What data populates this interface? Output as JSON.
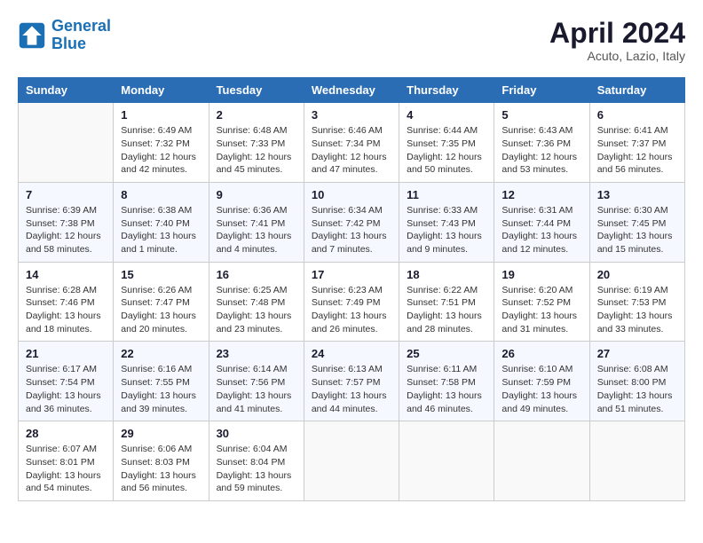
{
  "header": {
    "logo_line1": "General",
    "logo_line2": "Blue",
    "month_title": "April 2024",
    "subtitle": "Acuto, Lazio, Italy"
  },
  "weekdays": [
    "Sunday",
    "Monday",
    "Tuesday",
    "Wednesday",
    "Thursday",
    "Friday",
    "Saturday"
  ],
  "weeks": [
    [
      {
        "day": "",
        "info": ""
      },
      {
        "day": "1",
        "info": "Sunrise: 6:49 AM\nSunset: 7:32 PM\nDaylight: 12 hours\nand 42 minutes."
      },
      {
        "day": "2",
        "info": "Sunrise: 6:48 AM\nSunset: 7:33 PM\nDaylight: 12 hours\nand 45 minutes."
      },
      {
        "day": "3",
        "info": "Sunrise: 6:46 AM\nSunset: 7:34 PM\nDaylight: 12 hours\nand 47 minutes."
      },
      {
        "day": "4",
        "info": "Sunrise: 6:44 AM\nSunset: 7:35 PM\nDaylight: 12 hours\nand 50 minutes."
      },
      {
        "day": "5",
        "info": "Sunrise: 6:43 AM\nSunset: 7:36 PM\nDaylight: 12 hours\nand 53 minutes."
      },
      {
        "day": "6",
        "info": "Sunrise: 6:41 AM\nSunset: 7:37 PM\nDaylight: 12 hours\nand 56 minutes."
      }
    ],
    [
      {
        "day": "7",
        "info": "Sunrise: 6:39 AM\nSunset: 7:38 PM\nDaylight: 12 hours\nand 58 minutes."
      },
      {
        "day": "8",
        "info": "Sunrise: 6:38 AM\nSunset: 7:40 PM\nDaylight: 13 hours\nand 1 minute."
      },
      {
        "day": "9",
        "info": "Sunrise: 6:36 AM\nSunset: 7:41 PM\nDaylight: 13 hours\nand 4 minutes."
      },
      {
        "day": "10",
        "info": "Sunrise: 6:34 AM\nSunset: 7:42 PM\nDaylight: 13 hours\nand 7 minutes."
      },
      {
        "day": "11",
        "info": "Sunrise: 6:33 AM\nSunset: 7:43 PM\nDaylight: 13 hours\nand 9 minutes."
      },
      {
        "day": "12",
        "info": "Sunrise: 6:31 AM\nSunset: 7:44 PM\nDaylight: 13 hours\nand 12 minutes."
      },
      {
        "day": "13",
        "info": "Sunrise: 6:30 AM\nSunset: 7:45 PM\nDaylight: 13 hours\nand 15 minutes."
      }
    ],
    [
      {
        "day": "14",
        "info": "Sunrise: 6:28 AM\nSunset: 7:46 PM\nDaylight: 13 hours\nand 18 minutes."
      },
      {
        "day": "15",
        "info": "Sunrise: 6:26 AM\nSunset: 7:47 PM\nDaylight: 13 hours\nand 20 minutes."
      },
      {
        "day": "16",
        "info": "Sunrise: 6:25 AM\nSunset: 7:48 PM\nDaylight: 13 hours\nand 23 minutes."
      },
      {
        "day": "17",
        "info": "Sunrise: 6:23 AM\nSunset: 7:49 PM\nDaylight: 13 hours\nand 26 minutes."
      },
      {
        "day": "18",
        "info": "Sunrise: 6:22 AM\nSunset: 7:51 PM\nDaylight: 13 hours\nand 28 minutes."
      },
      {
        "day": "19",
        "info": "Sunrise: 6:20 AM\nSunset: 7:52 PM\nDaylight: 13 hours\nand 31 minutes."
      },
      {
        "day": "20",
        "info": "Sunrise: 6:19 AM\nSunset: 7:53 PM\nDaylight: 13 hours\nand 33 minutes."
      }
    ],
    [
      {
        "day": "21",
        "info": "Sunrise: 6:17 AM\nSunset: 7:54 PM\nDaylight: 13 hours\nand 36 minutes."
      },
      {
        "day": "22",
        "info": "Sunrise: 6:16 AM\nSunset: 7:55 PM\nDaylight: 13 hours\nand 39 minutes."
      },
      {
        "day": "23",
        "info": "Sunrise: 6:14 AM\nSunset: 7:56 PM\nDaylight: 13 hours\nand 41 minutes."
      },
      {
        "day": "24",
        "info": "Sunrise: 6:13 AM\nSunset: 7:57 PM\nDaylight: 13 hours\nand 44 minutes."
      },
      {
        "day": "25",
        "info": "Sunrise: 6:11 AM\nSunset: 7:58 PM\nDaylight: 13 hours\nand 46 minutes."
      },
      {
        "day": "26",
        "info": "Sunrise: 6:10 AM\nSunset: 7:59 PM\nDaylight: 13 hours\nand 49 minutes."
      },
      {
        "day": "27",
        "info": "Sunrise: 6:08 AM\nSunset: 8:00 PM\nDaylight: 13 hours\nand 51 minutes."
      }
    ],
    [
      {
        "day": "28",
        "info": "Sunrise: 6:07 AM\nSunset: 8:01 PM\nDaylight: 13 hours\nand 54 minutes."
      },
      {
        "day": "29",
        "info": "Sunrise: 6:06 AM\nSunset: 8:03 PM\nDaylight: 13 hours\nand 56 minutes."
      },
      {
        "day": "30",
        "info": "Sunrise: 6:04 AM\nSunset: 8:04 PM\nDaylight: 13 hours\nand 59 minutes."
      },
      {
        "day": "",
        "info": ""
      },
      {
        "day": "",
        "info": ""
      },
      {
        "day": "",
        "info": ""
      },
      {
        "day": "",
        "info": ""
      }
    ]
  ]
}
